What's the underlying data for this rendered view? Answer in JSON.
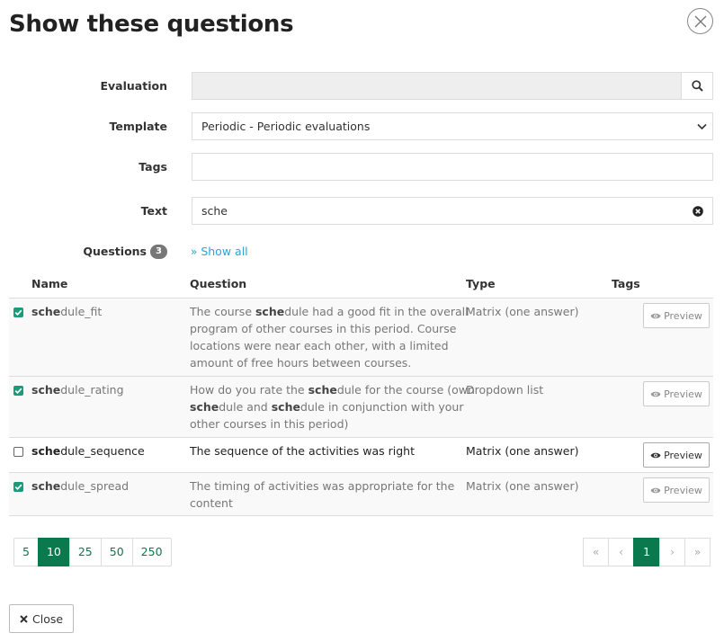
{
  "dialog": {
    "title": "Show these questions"
  },
  "form": {
    "evaluation_label": "Evaluation",
    "evaluation_value": "",
    "template_label": "Template",
    "template_value": "Periodic - Periodic evaluations",
    "tags_label": "Tags",
    "tags_value": "",
    "text_label": "Text",
    "text_value": "sche"
  },
  "questions": {
    "label": "Questions",
    "count": "3",
    "show_all": "Show all"
  },
  "table": {
    "headers": {
      "name": "Name",
      "question": "Question",
      "type": "Type",
      "tags": "Tags"
    },
    "rows": [
      {
        "checked": true,
        "name_match": "sche",
        "name_rest": "dule_fit",
        "question_lines": [
          [
            {
              "t": "The course "
            },
            {
              "t": "sche",
              "b": true
            },
            {
              "t": "dule had a good fit in the overall"
            }
          ],
          [
            {
              "t": "program of other courses in this period. Course"
            }
          ],
          [
            {
              "t": "locations were near each other, with a limited"
            }
          ],
          [
            {
              "t": "amount of free hours between courses."
            }
          ]
        ],
        "type": "Matrix (one answer)",
        "preview": "Preview"
      },
      {
        "checked": true,
        "name_match": "sche",
        "name_rest": "dule_rating",
        "question_lines": [
          [
            {
              "t": "How do you rate the "
            },
            {
              "t": "sche",
              "b": true
            },
            {
              "t": "dule for the course (own"
            }
          ],
          [
            {
              "t": "sche",
              "b": true
            },
            {
              "t": "dule and "
            },
            {
              "t": "sche",
              "b": true
            },
            {
              "t": "dule in conjunction with your"
            }
          ],
          [
            {
              "t": "other courses in this period)"
            }
          ]
        ],
        "type": "Dropdown list",
        "preview": "Preview"
      },
      {
        "checked": false,
        "name_match": "sche",
        "name_rest": "dule_sequence",
        "question_lines": [
          [
            {
              "t": "The sequence of the activities was right"
            }
          ]
        ],
        "type": "Matrix (one answer)",
        "preview": "Preview"
      },
      {
        "checked": true,
        "name_match": "sche",
        "name_rest": "dule_spread",
        "question_lines": [
          [
            {
              "t": "The timing of activities was appropriate for the"
            }
          ],
          [
            {
              "t": "content"
            }
          ]
        ],
        "type": "Matrix (one answer)",
        "preview": "Preview"
      }
    ]
  },
  "page_sizes": {
    "options": [
      "5",
      "10",
      "25",
      "50",
      "250"
    ],
    "selected": "10"
  },
  "pagination": {
    "first": "«",
    "prev": "‹",
    "current": "1",
    "next": "›",
    "last": "»"
  },
  "footer": {
    "close_label": "Close"
  },
  "colors": {
    "primary": "#0a7a4e",
    "link": "#2aa4d8",
    "check": "#1c9b7a",
    "badge": "#777777"
  }
}
